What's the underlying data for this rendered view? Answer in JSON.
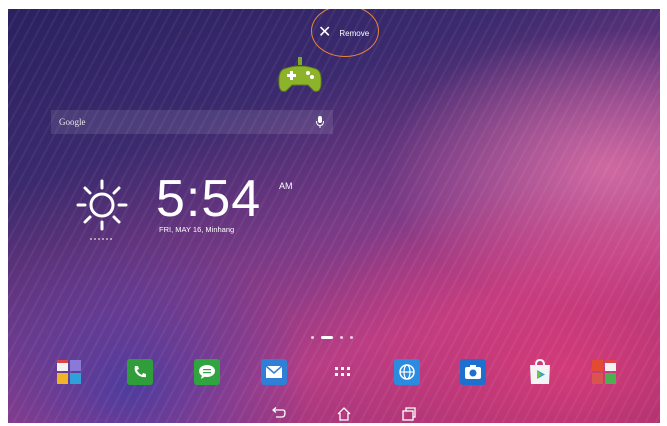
{
  "top_bar": {
    "remove_label": "Remove",
    "remove_icon": "close-icon",
    "highlight_color": "#e8833a"
  },
  "dragged_app": {
    "icon": "gamepad-icon",
    "color": "#8db32b"
  },
  "search_widget": {
    "label": "Google",
    "icon": "microphone-icon"
  },
  "clock_widget": {
    "time": "5:54",
    "ampm": "AM",
    "date": "FRI, MAY 16, Minhang",
    "weather_icon": "sun-icon"
  },
  "page_indicator": {
    "pages": 4,
    "current": 2
  },
  "dock": {
    "apps": [
      {
        "name": "app-folder-icon"
      },
      {
        "name": "phone-icon",
        "color": "#2f9e3a"
      },
      {
        "name": "messaging-icon",
        "color": "#2fa43f"
      },
      {
        "name": "email-icon",
        "color": "#2f7fd6"
      },
      {
        "name": "app-drawer-icon"
      },
      {
        "name": "browser-icon",
        "color": "#2b8be0"
      },
      {
        "name": "camera-icon",
        "color": "#1f6fcf"
      },
      {
        "name": "play-store-icon"
      },
      {
        "name": "google-folder-icon"
      }
    ]
  },
  "nav_bar": {
    "back": "back-icon",
    "home": "home-icon",
    "recents": "recents-icon"
  }
}
